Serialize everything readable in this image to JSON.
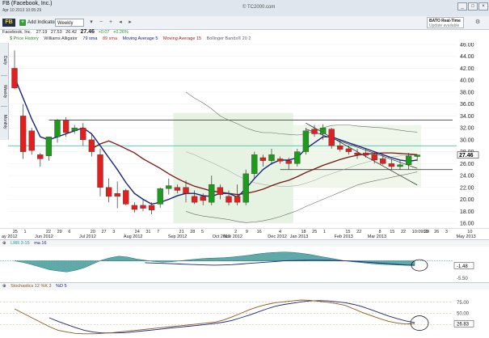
{
  "window": {
    "title": "FB (Facebook, Inc.)",
    "subtitle": "Apr 10 2013 10:05:29",
    "copyright": "© TC2000.com",
    "btn_min": "_",
    "btn_max": "□",
    "btn_close": "×"
  },
  "toolbar": {
    "symbol": "FB",
    "add_indicator": "Add Indicator",
    "period": "Weekly",
    "bato_lines": [
      "BATO Real-Time",
      "Update available"
    ]
  },
  "quote": {
    "company": "Facebook, Inc.",
    "open": "27.19",
    "high": "27.53",
    "low": "26.42",
    "last": "27.46",
    "change": "+0.07",
    "change_pct": "+0.26%"
  },
  "legend": {
    "items": [
      {
        "text": "Price History",
        "color": "#2a8a2a"
      },
      {
        "text": "Williams Alligator",
        "color": "#333333"
      },
      {
        "text": "79 sma",
        "color": "#1a237e"
      },
      {
        "text": "89 sma",
        "color": "#c62828"
      },
      {
        "text": "Moving Average 5",
        "color": "#1a237e"
      },
      {
        "text": "Moving Average 15",
        "color": "#8b1a1a"
      },
      {
        "text": "Bollinger Bands® 20 2",
        "color": "#666666"
      }
    ]
  },
  "side_tabs": [
    "Daily",
    "Weekly",
    "Monthly"
  ],
  "y_axis": {
    "ticks": [
      "46.00",
      "44.00",
      "42.00",
      "40.00",
      "38.00",
      "36.00",
      "34.00",
      "32.00",
      "30.00",
      "28.00",
      "26.00",
      "24.00",
      "22.00",
      "20.00",
      "18.00",
      "16.00"
    ],
    "last_price_label": "27.46"
  },
  "x_axis": {
    "labels": [
      "ay 2012",
      "25",
      "1",
      "Jun 2012",
      "22",
      "29",
      "6",
      "Jul 2012",
      "20",
      "27",
      "3",
      "Aug 2012",
      "24",
      "31",
      "7",
      "Sep 2012",
      "21",
      "28",
      "5",
      "Oct 2012",
      "Nov 2012",
      "2",
      "9",
      "16",
      "Dec 2012",
      "4",
      "Jan 2013",
      "18",
      "25",
      "1",
      "Feb 2013",
      "15",
      "22",
      "Mar 2013",
      "8",
      "15",
      "22",
      "10:09:29",
      "19",
      "26",
      "3",
      "May 2013",
      "10"
    ]
  },
  "chart_data": {
    "type": "candlestick",
    "ylim": [
      16,
      46
    ],
    "candles": [
      {
        "open": 42.0,
        "high": 45.0,
        "low": 38.5,
        "close": 38.7,
        "dir": "down"
      },
      {
        "open": 34.0,
        "high": 36.0,
        "low": 26.8,
        "close": 28.0,
        "dir": "down"
      },
      {
        "open": 31.5,
        "high": 32.0,
        "low": 27.5,
        "close": 28.2,
        "dir": "down"
      },
      {
        "open": 27.5,
        "high": 27.8,
        "low": 25.5,
        "close": 26.8,
        "dir": "down"
      },
      {
        "open": 27.3,
        "high": 30.5,
        "low": 26.5,
        "close": 30.5,
        "dir": "up"
      },
      {
        "open": 30.5,
        "high": 33.5,
        "low": 29.5,
        "close": 33.3,
        "dir": "up"
      },
      {
        "open": 33.3,
        "high": 33.8,
        "low": 30.5,
        "close": 31.2,
        "dir": "down"
      },
      {
        "open": 31.5,
        "high": 32.5,
        "low": 31.0,
        "close": 32.0,
        "dir": "up"
      },
      {
        "open": 32.0,
        "high": 32.8,
        "low": 29.0,
        "close": 30.0,
        "dir": "down"
      },
      {
        "open": 30.0,
        "high": 31.0,
        "low": 27.2,
        "close": 28.0,
        "dir": "down"
      },
      {
        "open": 27.5,
        "high": 28.5,
        "low": 20.5,
        "close": 22.0,
        "dir": "down"
      },
      {
        "open": 22.0,
        "high": 23.5,
        "low": 19.5,
        "close": 20.5,
        "dir": "down"
      },
      {
        "open": 21.0,
        "high": 23.0,
        "low": 18.5,
        "close": 20.5,
        "dir": "down"
      },
      {
        "open": 21.5,
        "high": 21.8,
        "low": 19.0,
        "close": 19.2,
        "dir": "down"
      },
      {
        "open": 19.0,
        "high": 19.5,
        "low": 17.8,
        "close": 18.3,
        "dir": "down"
      },
      {
        "open": 18.5,
        "high": 20.0,
        "low": 18.0,
        "close": 19.0,
        "dir": "down"
      },
      {
        "open": 19.0,
        "high": 19.5,
        "low": 17.5,
        "close": 18.2,
        "dir": "down"
      },
      {
        "open": 19.2,
        "high": 22.0,
        "low": 18.6,
        "close": 21.8,
        "dir": "up"
      },
      {
        "open": 21.8,
        "high": 23.5,
        "low": 20.8,
        "close": 22.3,
        "dir": "up"
      },
      {
        "open": 22.0,
        "high": 22.5,
        "low": 21.0,
        "close": 21.5,
        "dir": "down"
      },
      {
        "open": 22.0,
        "high": 23.2,
        "low": 19.5,
        "close": 21.0,
        "dir": "down"
      },
      {
        "open": 20.5,
        "high": 21.5,
        "low": 19.2,
        "close": 19.5,
        "dir": "down"
      },
      {
        "open": 20.5,
        "high": 21.0,
        "low": 19.0,
        "close": 19.8,
        "dir": "down"
      },
      {
        "open": 19.5,
        "high": 24.0,
        "low": 19.0,
        "close": 22.5,
        "dir": "up"
      },
      {
        "open": 22.0,
        "high": 22.5,
        "low": 20.0,
        "close": 20.8,
        "dir": "down"
      },
      {
        "open": 20.5,
        "high": 21.5,
        "low": 19.0,
        "close": 19.5,
        "dir": "down"
      },
      {
        "open": 19.5,
        "high": 22.5,
        "low": 19.0,
        "close": 20.5,
        "dir": "down"
      },
      {
        "open": 19.5,
        "high": 25.0,
        "low": 19.0,
        "close": 24.3,
        "dir": "up"
      },
      {
        "open": 24.3,
        "high": 28.0,
        "low": 23.5,
        "close": 27.5,
        "dir": "up"
      },
      {
        "open": 27.0,
        "high": 27.5,
        "low": 25.5,
        "close": 26.5,
        "dir": "down"
      },
      {
        "open": 26.5,
        "high": 28.5,
        "low": 25.8,
        "close": 27.5,
        "dir": "up"
      },
      {
        "open": 26.8,
        "high": 27.2,
        "low": 26.0,
        "close": 26.4,
        "dir": "down"
      },
      {
        "open": 26.5,
        "high": 27.0,
        "low": 25.0,
        "close": 26.0,
        "dir": "down"
      },
      {
        "open": 26.0,
        "high": 28.5,
        "low": 25.5,
        "close": 28.0,
        "dir": "up"
      },
      {
        "open": 28.0,
        "high": 32.0,
        "low": 27.5,
        "close": 31.5,
        "dir": "up"
      },
      {
        "open": 31.8,
        "high": 32.5,
        "low": 30.5,
        "close": 31.0,
        "dir": "down"
      },
      {
        "open": 31.0,
        "high": 32.6,
        "low": 30.0,
        "close": 32.0,
        "dir": "up"
      },
      {
        "open": 31.8,
        "high": 32.0,
        "low": 28.5,
        "close": 29.0,
        "dir": "down"
      },
      {
        "open": 29.0,
        "high": 30.0,
        "low": 28.0,
        "close": 28.4,
        "dir": "down"
      },
      {
        "open": 28.5,
        "high": 29.0,
        "low": 27.5,
        "close": 28.0,
        "dir": "down"
      },
      {
        "open": 27.8,
        "high": 28.5,
        "low": 26.8,
        "close": 27.5,
        "dir": "down"
      },
      {
        "open": 27.8,
        "high": 28.5,
        "low": 27.0,
        "close": 27.4,
        "dir": "down"
      },
      {
        "open": 27.5,
        "high": 28.0,
        "low": 26.0,
        "close": 26.6,
        "dir": "down"
      },
      {
        "open": 26.8,
        "high": 27.5,
        "low": 25.8,
        "close": 26.0,
        "dir": "down"
      },
      {
        "open": 26.0,
        "high": 26.8,
        "low": 25.0,
        "close": 25.5,
        "dir": "down"
      },
      {
        "open": 25.5,
        "high": 26.5,
        "low": 25.0,
        "close": 25.8,
        "dir": "up"
      },
      {
        "open": 25.8,
        "high": 27.8,
        "low": 25.0,
        "close": 27.3,
        "dir": "up"
      },
      {
        "open": 27.19,
        "high": 27.53,
        "low": 26.42,
        "close": 27.46,
        "dir": "up"
      }
    ],
    "ma5": [
      40.5,
      37,
      33.5,
      30.5,
      30,
      30.5,
      31,
      31.5,
      32,
      31,
      29,
      27,
      25,
      22.8,
      21,
      20,
      19.2,
      19.5,
      20,
      20.6,
      21,
      21,
      20.6,
      20.5,
      21,
      21,
      20.4,
      21.8,
      23.5,
      25,
      26,
      26.6,
      26.6,
      27,
      28.5,
      29.5,
      30.5,
      30.5,
      30,
      29.5,
      29,
      28.5,
      28,
      27.5,
      27,
      26.6,
      26.4,
      26.6
    ],
    "ma15": [
      null,
      null,
      null,
      null,
      null,
      null,
      null,
      null,
      null,
      28.5,
      29.3,
      29.8,
      29.2,
      28.5,
      27.8,
      26.8,
      26,
      25.2,
      24.3,
      23.5,
      22.8,
      22.2,
      21.8,
      21.4,
      21.2,
      21,
      20.8,
      21,
      21.3,
      21.7,
      22.3,
      22.8,
      23.2,
      23.8,
      24.5,
      25.1,
      25.7,
      26.2,
      26.7,
      27.1,
      27.4,
      27.6,
      27.7,
      27.8,
      27.8,
      27.7,
      27.6,
      27.5
    ],
    "boll_upper": [
      null,
      null,
      null,
      null,
      null,
      null,
      null,
      null,
      null,
      null,
      null,
      null,
      null,
      null,
      null,
      null,
      null,
      null,
      null,
      null,
      38,
      37,
      36.2,
      35.2,
      34,
      33.3,
      32.7,
      32,
      31.5,
      31.2,
      31.2,
      31,
      30.9,
      30.8,
      31,
      31.5,
      32,
      32.4,
      32.5,
      32.5,
      32.3,
      32.2,
      32.1,
      32,
      31.8,
      31.6,
      31.4,
      31.3
    ],
    "boll_mid": [
      null,
      null,
      null,
      null,
      null,
      null,
      null,
      null,
      null,
      null,
      null,
      null,
      null,
      null,
      null,
      null,
      null,
      null,
      null,
      null,
      28,
      27.5,
      26.8,
      26.2,
      25.5,
      24.8,
      24,
      23.3,
      22.8,
      22.5,
      22.3,
      22.2,
      22.2,
      22.3,
      22.7,
      23.2,
      23.8,
      24.3,
      24.8,
      25.3,
      25.8,
      26.2,
      26.6,
      26.9,
      27.1,
      27.3,
      27.4,
      27.5
    ],
    "boll_lower": [
      null,
      null,
      null,
      null,
      null,
      null,
      null,
      null,
      null,
      null,
      null,
      null,
      null,
      null,
      null,
      null,
      null,
      null,
      null,
      null,
      18,
      17.5,
      17.2,
      17,
      16.8,
      16.6,
      16.3,
      16.1,
      16.2,
      16.4,
      16.7,
      17.1,
      17.6,
      18.1,
      18.8,
      19.4,
      20,
      20.6,
      21.2,
      21.8,
      22.4,
      22.8,
      23.1,
      23.4,
      23.7,
      24,
      24.3,
      24.6
    ],
    "resistance_level": 33.3,
    "support_level": 25.0,
    "reference_level": 29.0,
    "downtrend_line": {
      "from": [
        32.8,
        34
      ],
      "to": [
        22.4,
        47
      ]
    },
    "second_trend_line": {
      "from": [
        31.8,
        34
      ],
      "to": [
        25.2,
        47
      ]
    }
  },
  "lrr_panel": {
    "label": "LRR 3-15",
    "ma_label": "ma 16",
    "value_label": "-1.48",
    "level_label": "-5.50",
    "values": [
      0,
      -0.5,
      -1.2,
      -2,
      -2.8,
      -3.2,
      -3.5,
      -3,
      -2.2,
      -1,
      0.2,
      1,
      1.5,
      1.2,
      0.6,
      0.2,
      -0.2,
      -0.4,
      -0.3,
      0,
      0.3,
      0.6,
      0.8,
      0.9,
      1,
      1.2,
      1.5,
      1.8,
      2.2,
      2.5,
      2.7,
      2.8,
      2.7,
      2.4,
      2,
      1.5,
      1,
      0.5,
      0,
      -0.3,
      -0.6,
      -0.9,
      -1.1,
      -1.2,
      -1.3,
      -1.4,
      -1.48
    ],
    "ma_values": [
      null,
      null,
      null,
      null,
      null,
      null,
      null,
      null,
      null,
      null,
      null,
      null,
      null,
      null,
      null,
      -0.6,
      -0.7,
      -0.8,
      -0.9,
      -1,
      -1.1,
      -1.2,
      -1.3,
      -1.35,
      -1.3,
      -1.2,
      -1,
      -0.8,
      -0.6,
      -0.4,
      -0.2,
      0,
      0.1,
      0.15,
      0.2,
      0.2,
      0.15,
      0.1,
      0,
      -0.1,
      -0.3,
      -0.5,
      -0.7,
      -0.9,
      -1.1,
      -1.3,
      -1.4
    ],
    "ylim": [
      -6,
      4
    ]
  },
  "stoch_panel": {
    "label": "Stochastics 12 %K 3",
    "d_label": "%D 5",
    "value_label": "26.83",
    "ticks": [
      "75.00",
      "50.00",
      "25.00"
    ],
    "k_values": [
      60,
      50,
      40,
      30,
      20,
      12,
      8,
      5,
      4,
      4,
      5,
      6,
      8,
      10,
      12,
      14,
      16,
      18,
      20,
      22,
      24,
      26,
      28,
      30,
      35,
      42,
      50,
      58,
      65,
      70,
      74,
      76,
      78,
      80,
      79,
      77,
      75,
      72,
      68,
      60,
      52,
      45,
      38,
      32,
      28,
      26,
      26.83
    ],
    "d_values": [
      null,
      null,
      null,
      null,
      40,
      32,
      25,
      18,
      12,
      8,
      6,
      6,
      6,
      7,
      9,
      11,
      13,
      15,
      17,
      19,
      21,
      23,
      25,
      27,
      30,
      34,
      40,
      46,
      53,
      60,
      66,
      70,
      73,
      76,
      78,
      78.5,
      78,
      76,
      74,
      70,
      65,
      58,
      51,
      44,
      38,
      33,
      29
    ],
    "ylim": [
      0,
      100
    ]
  },
  "colors": {
    "up_candle": "#1f9a1f",
    "down_candle": "#e02020",
    "teal_line": "#2fb7a4",
    "ma5": "#1a237e",
    "ma15": "#7a1515",
    "boll": "#6b6b6b",
    "lrr_fill": "#2a8c8c"
  }
}
